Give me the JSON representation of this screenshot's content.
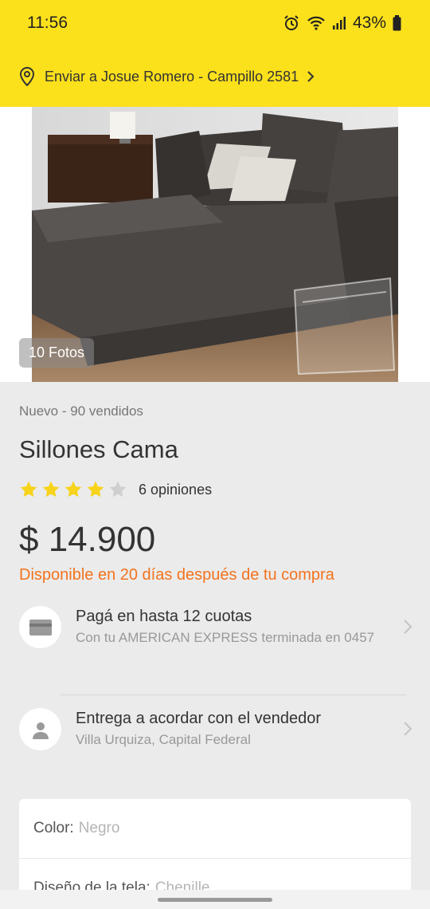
{
  "status": {
    "time": "11:56",
    "battery": "43%"
  },
  "header": {
    "ship_to": "Enviar a Josue Romero - Campillo 2581"
  },
  "gallery": {
    "photo_count": "10 Fotos"
  },
  "product": {
    "condition": "Nuevo - 90 vendidos",
    "title": "Sillones Cama",
    "rating": 4,
    "rating_max": 5,
    "reviews": "6 opiniones",
    "price": "$ 14.900",
    "availability": "Disponible en 20 días después de tu compra"
  },
  "payment": {
    "title": "Pagá en hasta 12 cuotas",
    "subtitle": "Con tu AMERICAN EXPRESS terminada en 0457"
  },
  "delivery": {
    "title": "Entrega a acordar con el vendedor",
    "subtitle": "Villa Urquiza, Capital Federal"
  },
  "specs": [
    {
      "key": "Color:",
      "value": "Negro"
    },
    {
      "key": "Diseño de la tela:",
      "value": "Chenille"
    }
  ],
  "colors": {
    "brand_yellow": "#fbe01c",
    "accent_orange": "#f3731d",
    "star": "#f7d31b"
  }
}
